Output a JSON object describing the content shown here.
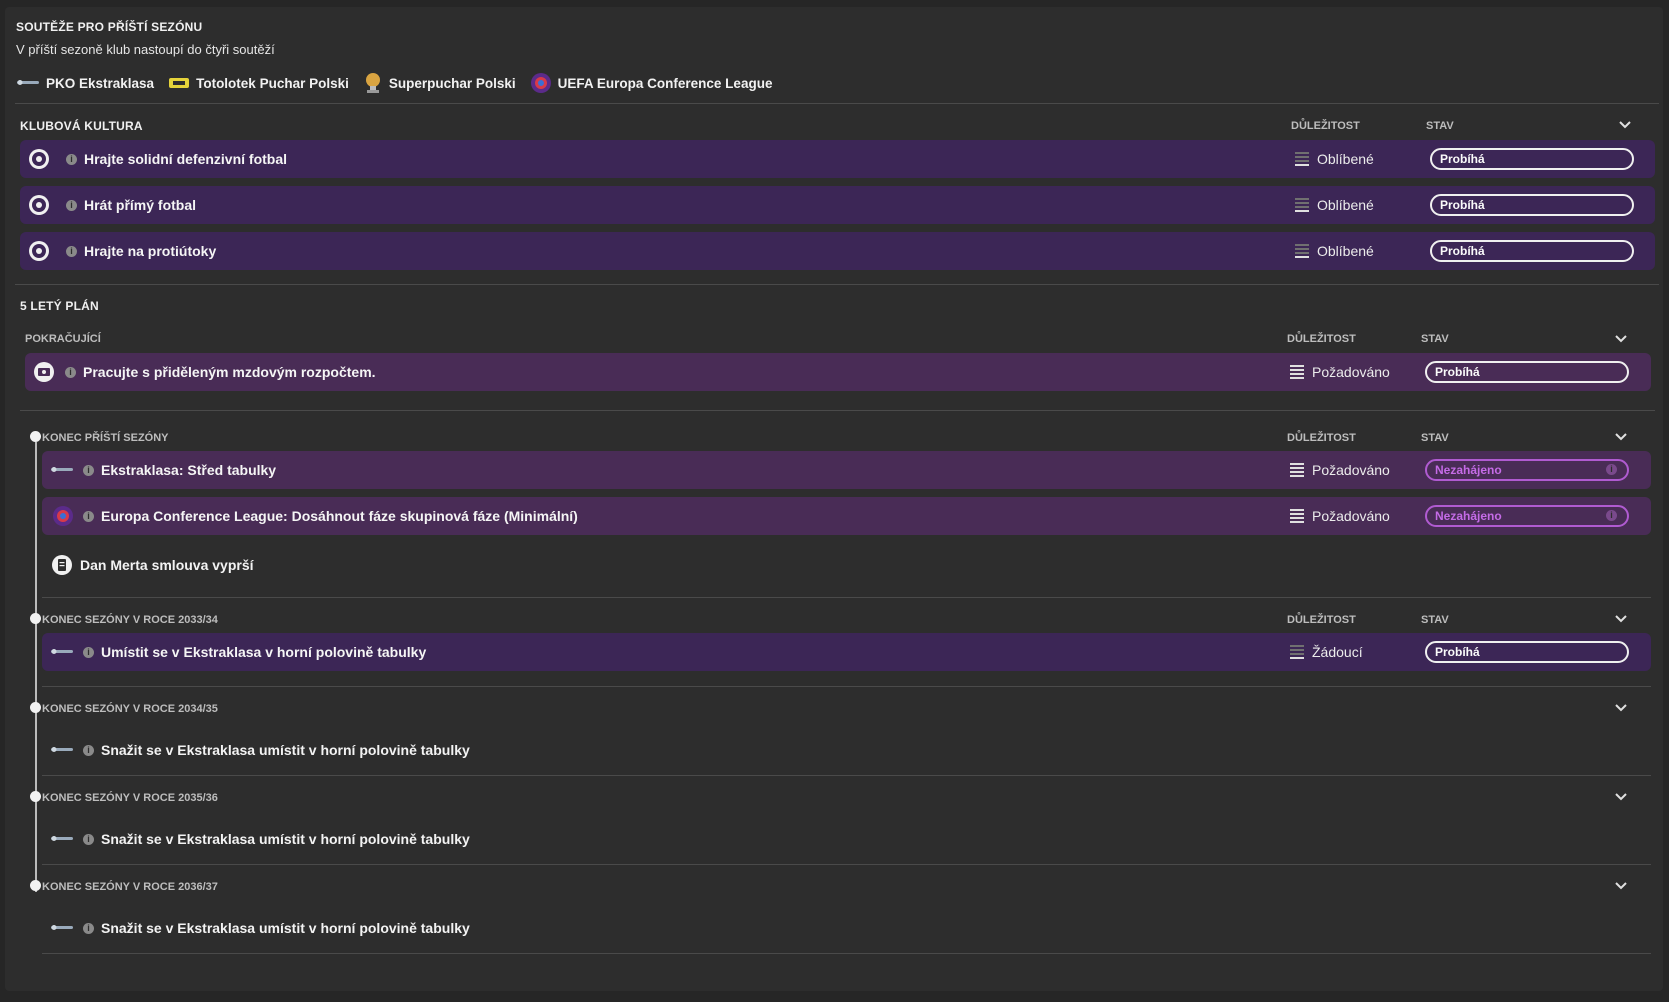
{
  "header": {
    "title": "SOUTĚŽE PRO PŘÍŠTÍ SEZÓNU",
    "subtitle": "V příští sezoně klub nastoupí do čtyři soutěží",
    "competitions": [
      {
        "name": "PKO Ekstraklasa",
        "icon": "ekstraklasa-logo-icon"
      },
      {
        "name": "Totolotek Puchar Polski",
        "icon": "puchar-polski-logo-icon"
      },
      {
        "name": "Superpuchar Polski",
        "icon": "superpuchar-trophy-icon"
      },
      {
        "name": "UEFA Europa Conference League",
        "icon": "uefa-conference-league-logo-icon"
      }
    ]
  },
  "club_culture": {
    "title": "KLUBOVÁ KULTURA",
    "col_importance": "DŮLEŽITOST",
    "col_status": "STAV",
    "rows": [
      {
        "label": "Hrajte solidní defenzivní fotbal",
        "importance": "Oblíbené",
        "status": "Probíhá"
      },
      {
        "label": "Hrát přímý fotbal",
        "importance": "Oblíbené",
        "status": "Probíhá"
      },
      {
        "label": "Hrajte na protiútoky",
        "importance": "Oblíbené",
        "status": "Probíhá"
      }
    ]
  },
  "plan": {
    "title": "5 LETÝ PLÁN",
    "ongoing": {
      "title": "POKRAČUJÍCÍ",
      "col_importance": "DŮLEŽITOST",
      "col_status": "STAV",
      "row": {
        "label": "Pracujte s přiděleným mzdovým rozpočtem.",
        "importance": "Požadováno",
        "status": "Probíhá"
      }
    },
    "next_season": {
      "title": "KONEC PŘÍŠTÍ SEZÓNY",
      "col_importance": "DŮLEŽITOST",
      "col_status": "STAV",
      "rows": [
        {
          "label": "Ekstraklasa: Střed tabulky",
          "importance": "Požadováno",
          "status": "Nezahájeno"
        },
        {
          "label": "Europa Conference League: Dosáhnout fáze skupinová fáze (Minimální)",
          "importance": "Požadováno",
          "status": "Nezahájeno"
        }
      ],
      "note": "Dan Merta smlouva vyprší"
    },
    "season_2033": {
      "title": "KONEC SEZÓNY V ROCE 2033/34",
      "col_importance": "DŮLEŽITOST",
      "col_status": "STAV",
      "row": {
        "label": "Umístit se v Ekstraklasa v horní polovině tabulky",
        "importance": "Žádoucí",
        "status": "Probíhá"
      }
    },
    "season_2034": {
      "title": "KONEC SEZÓNY V ROCE 2034/35",
      "item": "Snažit se v Ekstraklasa umístit v horní polovině tabulky"
    },
    "season_2035": {
      "title": "KONEC SEZÓNY V ROCE 2035/36",
      "item": "Snažit se v Ekstraklasa umístit v horní polovině tabulky"
    },
    "season_2036": {
      "title": "KONEC SEZÓNY V ROCE 2036/37",
      "item": "Snažit se v Ekstraklasa umístit v horní polovině tabulky"
    }
  },
  "colors": {
    "background": "#2d2d2d",
    "row_violet": "#3c2656",
    "row_plum": "#492c56",
    "status_pending": "#c46be6"
  }
}
